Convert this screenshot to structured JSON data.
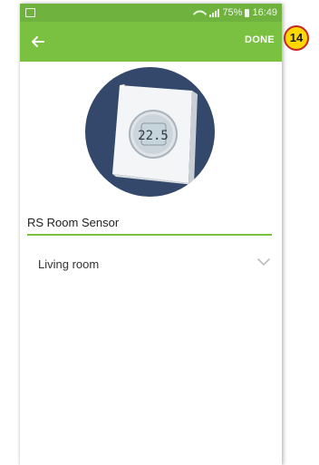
{
  "status_bar": {
    "battery": "75%",
    "time": "16:49",
    "icons": [
      "screenshot-icon",
      "wifi-icon",
      "signal-icon",
      "battery-icon"
    ]
  },
  "app_bar": {
    "back_icon": "arrow-left-icon",
    "done_label": "DONE",
    "color": "#7ac142"
  },
  "annotation": {
    "step_number": "14",
    "badge_color": "#ffd800",
    "badge_border": "#c62828"
  },
  "device": {
    "image": "thermostat-device-photo",
    "display_reading": "22.5"
  },
  "form": {
    "device_name": "RS Room Sensor",
    "room": "Living room",
    "accent_color": "#7ac142"
  }
}
